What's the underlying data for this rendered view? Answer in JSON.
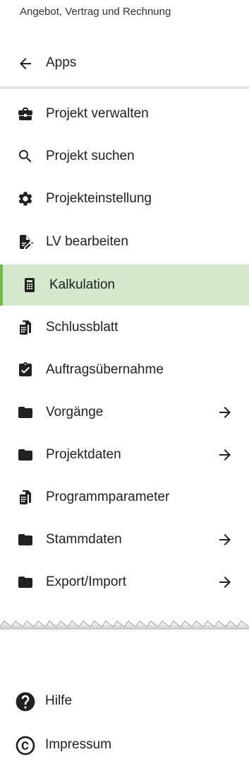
{
  "header": {
    "title": "Angebot, Vertrag und Rechnung"
  },
  "back": {
    "label": "Apps",
    "icon": "arrow-left-icon"
  },
  "menu": {
    "items": [
      {
        "label": "Projekt verwalten",
        "icon": "briefcase-icon"
      },
      {
        "label": "Projekt suchen",
        "icon": "search-icon"
      },
      {
        "label": "Projekteinstellung",
        "icon": "gear-icon"
      },
      {
        "label": "LV bearbeiten",
        "icon": "document-edit-icon"
      },
      {
        "label": "Kalkulation",
        "icon": "calculator-icon",
        "active": true
      },
      {
        "label": "Schlussblatt",
        "icon": "spreadsheet-icon"
      },
      {
        "label": "Auftragsübernahme",
        "icon": "clipboard-check-icon"
      },
      {
        "label": "Vorgänge",
        "icon": "folder-icon",
        "has_submenu": true
      },
      {
        "label": "Projektdaten",
        "icon": "folder-icon",
        "has_submenu": true
      },
      {
        "label": "Programmparameter",
        "icon": "spreadsheet-icon"
      },
      {
        "label": "Stammdaten",
        "icon": "folder-icon",
        "has_submenu": true
      },
      {
        "label": "Export/Import",
        "icon": "folder-icon",
        "has_submenu": true
      }
    ]
  },
  "footer": {
    "items": [
      {
        "label": "Hilfe",
        "icon": "help-circle-icon"
      },
      {
        "label": "Impressum",
        "icon": "copyright-icon"
      }
    ]
  },
  "colors": {
    "active_bg": "#d4e8cc",
    "active_accent": "#6cbd45",
    "icon": "#212121"
  }
}
